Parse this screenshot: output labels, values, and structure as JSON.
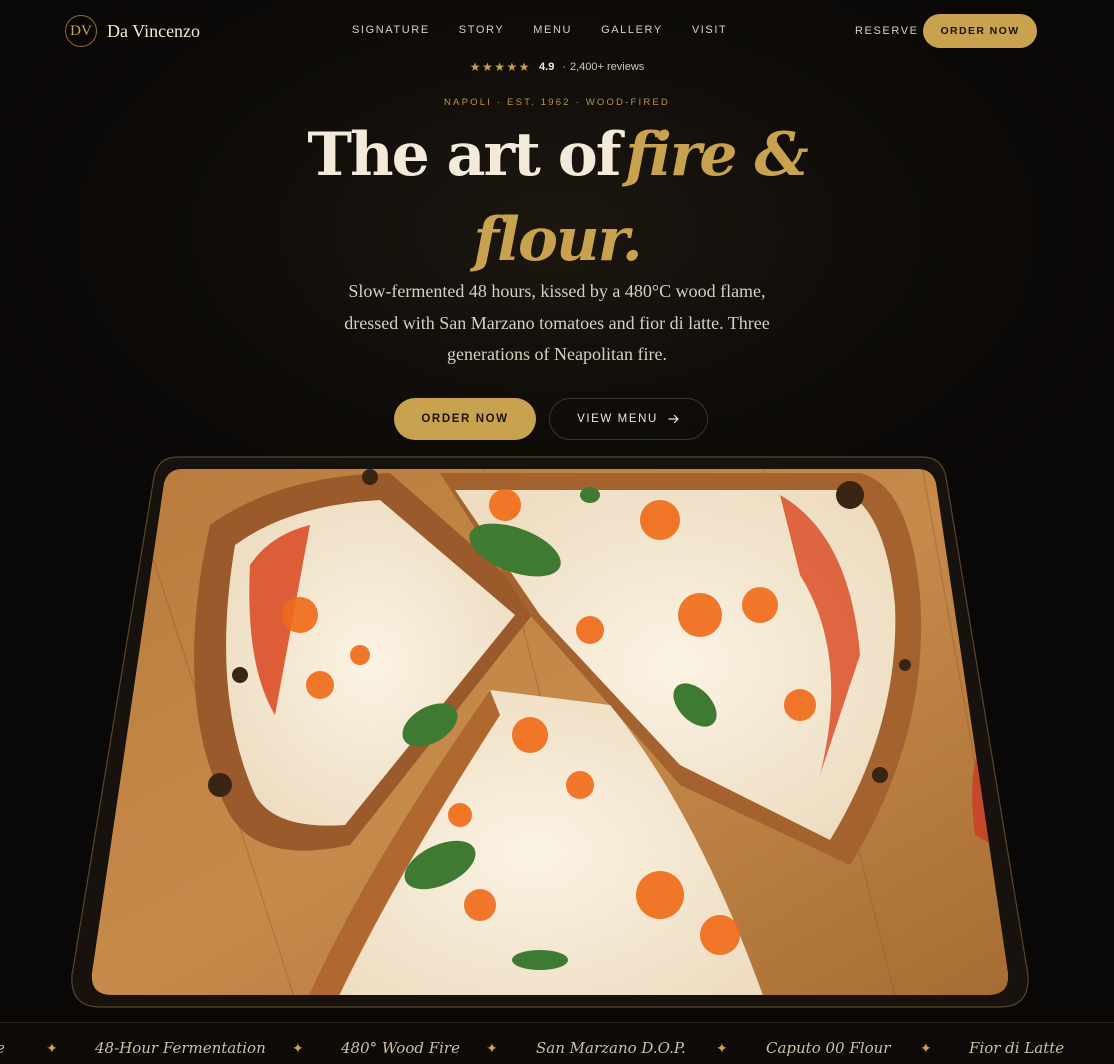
{
  "brand": {
    "monogram": "DV",
    "name": "Da Vincenzo"
  },
  "nav": {
    "links": [
      "SIGNATURE",
      "STORY",
      "MENU",
      "GALLERY",
      "VISIT"
    ],
    "reserve_label": "RESERVE",
    "order_label": "ORDER NOW"
  },
  "rating": {
    "stars": "★★★★★",
    "value": "4.9",
    "separator": "·",
    "count": "2,400+ reviews"
  },
  "hero": {
    "eyebrow": "NAPOLI · EST. 1962 · WOOD-FIRED",
    "headline_plain": "The art of",
    "headline_accent_1": "fire &",
    "headline_accent_2": "flour.",
    "subcopy": "Slow-fermented 48 hours, kissed by a 480°C wood flame, dressed with San Marzano tomatoes and fior di latte. Three generations of Neapolitan fire.",
    "cta_primary": "ORDER NOW",
    "cta_secondary": "VIEW MENU",
    "cta_secondary_icon": "arrow-right-icon"
  },
  "marquee": {
    "leading_fragment": "e",
    "items": [
      "48-Hour Fermentation",
      "480° Wood Fire",
      "San Marzano D.O.P.",
      "Caputo 00 Flour",
      "Fior di Latte"
    ],
    "separator_icon": "sparkle-icon"
  },
  "colors": {
    "accent": "#c9a24f",
    "background": "#0f0c09",
    "text": "#efe6d6"
  }
}
